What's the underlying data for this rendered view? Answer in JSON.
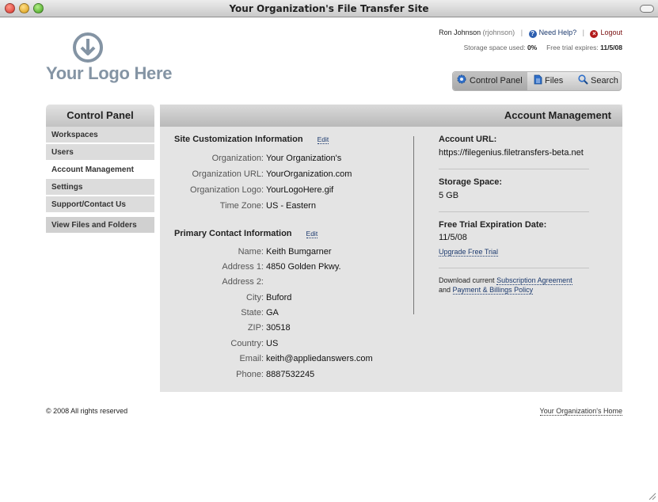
{
  "window": {
    "title": "Your Organization's File Transfer Site"
  },
  "logo": {
    "text": "Your Logo Here"
  },
  "user": {
    "name": "Ron Johnson",
    "username": "(rjohnson)",
    "help_label": "Need Help?",
    "logout_label": "Logout",
    "storage_label": "Storage space used:",
    "storage_value": "0%",
    "trial_label": "Free trial expires:",
    "trial_value": "11/5/08"
  },
  "topnav": {
    "items": [
      {
        "label": "Control Panel",
        "icon": "gear-icon",
        "active": true
      },
      {
        "label": "Files",
        "icon": "document-icon",
        "active": false
      },
      {
        "label": "Search",
        "icon": "magnifier-icon",
        "active": false
      }
    ]
  },
  "sidebar": {
    "title": "Control Panel",
    "items": [
      {
        "label": "Workspaces"
      },
      {
        "label": "Users"
      },
      {
        "label": "Account Management",
        "active": true
      },
      {
        "label": "Settings"
      },
      {
        "label": "Support/Contact Us"
      }
    ],
    "view_label": "View Files and Folders"
  },
  "main": {
    "title": "Account Management",
    "site_section": {
      "title": "Site Customization Information",
      "edit_label": "Edit",
      "fields": [
        {
          "label": "Organization:",
          "value": "Your Organization's"
        },
        {
          "label": "Organization URL:",
          "value": "YourOrganization.com"
        },
        {
          "label": "Organization Logo:",
          "value": "YourLogoHere.gif"
        },
        {
          "label": "Time Zone:",
          "value": "US - Eastern"
        }
      ]
    },
    "contact_section": {
      "title": "Primary Contact Information",
      "edit_label": "Edit",
      "fields": [
        {
          "label": "Name:",
          "value": "Keith Bumgarner"
        },
        {
          "label": "Address 1:",
          "value": "4850 Golden Pkwy."
        },
        {
          "label": "Address 2:",
          "value": ""
        },
        {
          "label": "City:",
          "value": "Buford"
        },
        {
          "label": "State:",
          "value": "GA"
        },
        {
          "label": "ZIP:",
          "value": "30518"
        },
        {
          "label": "Country:",
          "value": "US"
        },
        {
          "label": "Email:",
          "value": "keith@appliedanswers.com"
        },
        {
          "label": "Phone:",
          "value": "8887532245"
        }
      ]
    },
    "account": {
      "url_label": "Account URL:",
      "url_value": "https://filegenius.filetransfers-beta.net",
      "storage_label": "Storage Space:",
      "storage_value": "5 GB",
      "trial_label": "Free Trial Expiration Date:",
      "trial_value": "11/5/08",
      "upgrade_label": "Upgrade Free Trial",
      "download_prefix": "Download current",
      "subscription_label": "Subscription Agreement",
      "and_label": "and",
      "policy_label": "Payment & Billings Policy"
    }
  },
  "footer": {
    "copyright": "© 2008 All rights reserved",
    "home_link": "Your Organization's Home"
  },
  "colors": {
    "link": "#1c3a6e",
    "logo": "#8494a4",
    "panel": "#e4e4e4"
  }
}
